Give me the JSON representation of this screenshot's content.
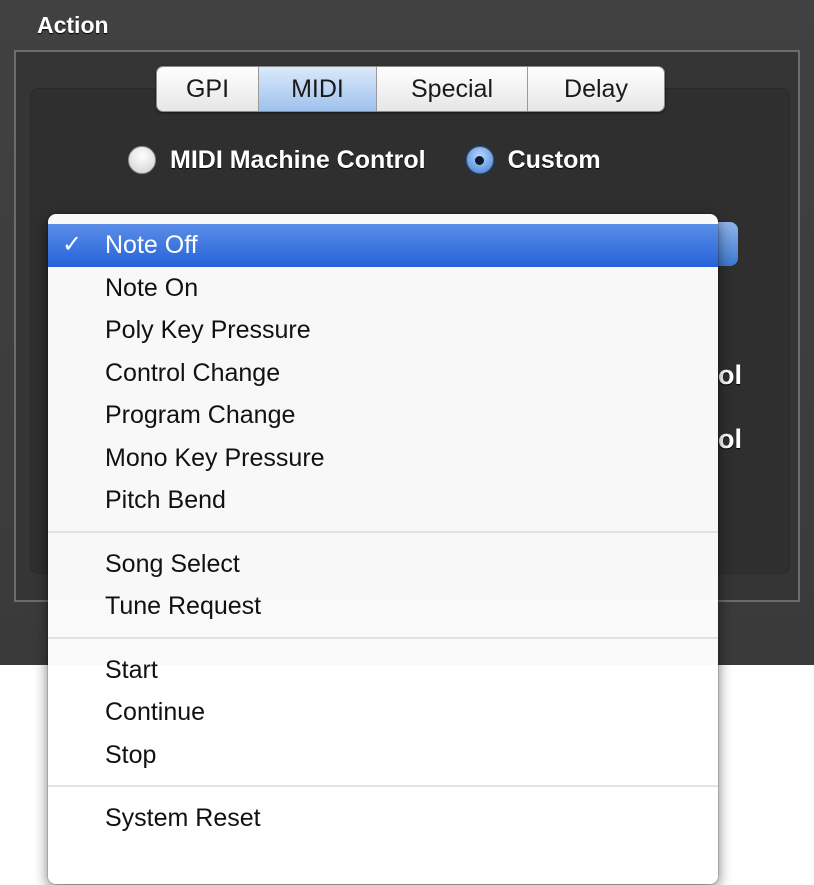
{
  "section": {
    "title": "Action"
  },
  "tabs": [
    {
      "label": "GPI",
      "selected": false
    },
    {
      "label": "MIDI",
      "selected": true
    },
    {
      "label": "Special",
      "selected": false
    },
    {
      "label": "Delay",
      "selected": false
    }
  ],
  "mode": {
    "options": [
      {
        "label": "MIDI Machine Control",
        "selected": false
      },
      {
        "label": "Custom",
        "selected": true
      }
    ]
  },
  "background": {
    "volume_label_1": "ol",
    "volume_label_2": "ol"
  },
  "menu": {
    "selected": "Note Off",
    "checkmark": "✓",
    "groups": [
      [
        "Note Off",
        "Note On",
        "Poly Key Pressure",
        "Control Change",
        "Program Change",
        "Mono Key Pressure",
        "Pitch Bend"
      ],
      [
        "Song Select",
        "Tune Request"
      ],
      [
        "Start",
        "Continue",
        "Stop"
      ],
      [
        "System Reset"
      ]
    ]
  },
  "colors": {
    "selection_blue": "#2563d9",
    "panel_background": "#3a3a3a"
  }
}
